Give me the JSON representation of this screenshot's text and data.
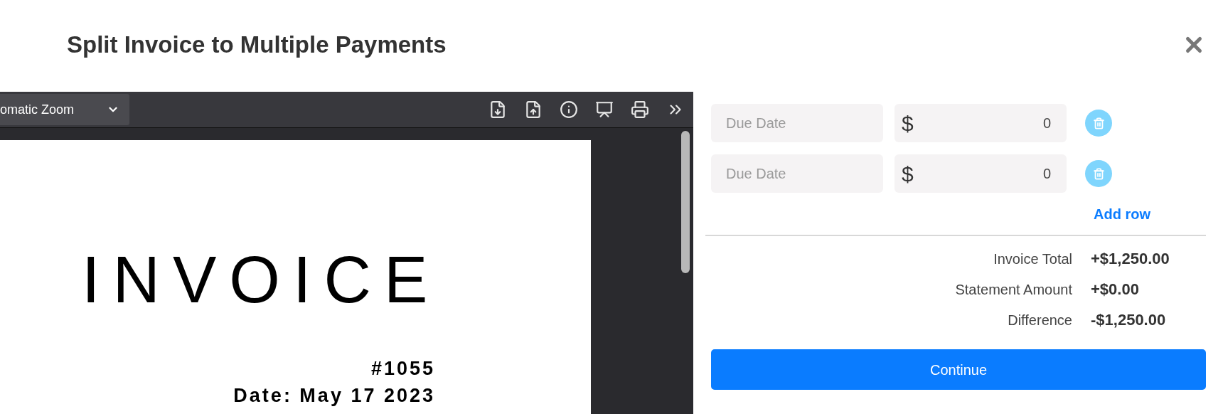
{
  "dialog": {
    "title": "Split Invoice to Multiple Payments"
  },
  "pdf_viewer": {
    "zoom_select": "omatic Zoom",
    "document": {
      "heading": "INVOICE",
      "lines": [
        "#1055",
        "Date: May 17 2023"
      ]
    }
  },
  "payments": [
    {
      "due_date_placeholder": "Due Date",
      "currency": "$",
      "amount": "0"
    },
    {
      "due_date_placeholder": "Due Date",
      "currency": "$",
      "amount": "0"
    }
  ],
  "add_row": "Add row",
  "totals": [
    {
      "label": "Invoice Total",
      "value": "+$1,250.00"
    },
    {
      "label": "Statement Amount",
      "value": "+$0.00"
    },
    {
      "label": "Difference",
      "value": "-$1,250.00"
    }
  ],
  "continue_button": "Continue"
}
